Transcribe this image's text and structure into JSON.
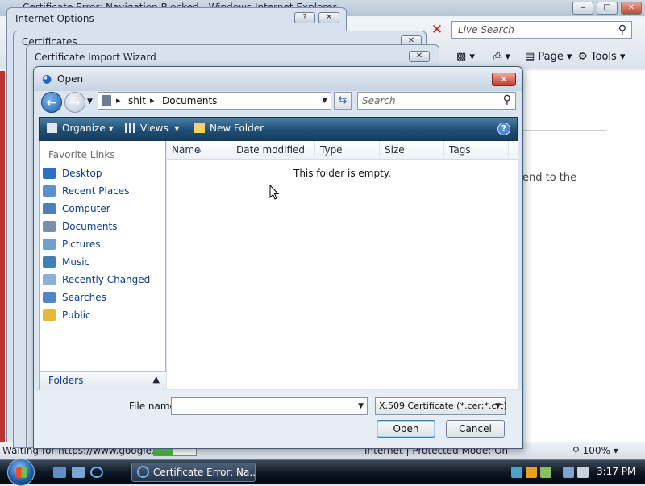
{
  "ie": {
    "title": "Certificate Error: Navigation Blocked - Windows Internet Explorer",
    "search_placeholder": "Live Search",
    "cmdbar": {
      "page": "Page",
      "tools": "Tools"
    },
    "background_text": "end to the",
    "status_text": "Waiting for https://www.google.cc",
    "progress_fraction": 0.45,
    "zone_text": "Internet | Protected Mode: On",
    "zoom": "100%"
  },
  "dialogs": {
    "internet_options_title": "Internet Options",
    "certificates_title": "Certificates",
    "import_wizard_title": "Certificate Import Wizard"
  },
  "open_dialog": {
    "title": "Open",
    "address": [
      "shit",
      "Documents"
    ],
    "search_placeholder": "Search",
    "toolbar": {
      "organize": "Organize",
      "views": "Views",
      "new_folder": "New Folder"
    },
    "nav_header": "Favorite Links",
    "nav_links": [
      {
        "label": "Desktop",
        "icon": "desktop-icon",
        "color": "#2d6fc2"
      },
      {
        "label": "Recent Places",
        "icon": "recent-places-icon",
        "color": "#5d8fcf"
      },
      {
        "label": "Computer",
        "icon": "computer-icon",
        "color": "#4f7fb8"
      },
      {
        "label": "Documents",
        "icon": "documents-icon",
        "color": "#7a8fa8"
      },
      {
        "label": "Pictures",
        "icon": "pictures-icon",
        "color": "#6f9fcf"
      },
      {
        "label": "Music",
        "icon": "music-icon",
        "color": "#3e7fb8"
      },
      {
        "label": "Recently Changed",
        "icon": "recently-changed-icon",
        "color": "#8fb0d6"
      },
      {
        "label": "Searches",
        "icon": "searches-icon",
        "color": "#4f86c6"
      },
      {
        "label": "Public",
        "icon": "public-icon",
        "color": "#e8b838"
      }
    ],
    "folders_label": "Folders",
    "columns": [
      "Name",
      "Date modified",
      "Type",
      "Size",
      "Tags"
    ],
    "empty_message": "This folder is empty.",
    "file_name_label": "File name:",
    "file_name_value": "",
    "filter": "X.509 Certificate (*.cer;*.crt)",
    "buttons": {
      "open": "Open",
      "cancel": "Cancel"
    }
  },
  "taskbar": {
    "task_button": "Certificate Error: Na...",
    "clock": "3:17 PM"
  }
}
